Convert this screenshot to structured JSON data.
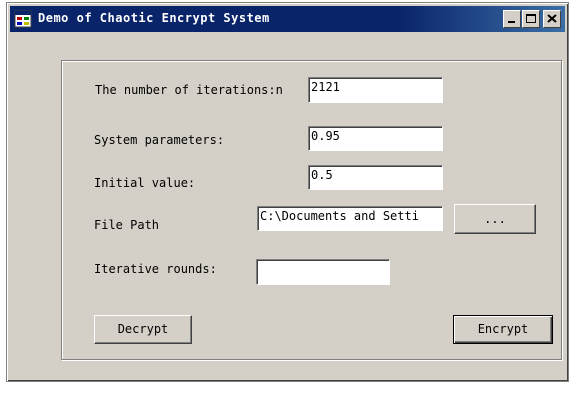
{
  "window": {
    "title": "Demo of Chaotic Encrypt System"
  },
  "form": {
    "iterations_label": "The number of iterations:n",
    "iterations_value": "2121",
    "system_params_label": "System parameters:",
    "system_params_value": "0.95",
    "initial_value_label": "Initial value:",
    "initial_value_value": "0.5",
    "file_path_label": "File Path",
    "file_path_value": "C:\\Documents and Setti",
    "browse_label": "...",
    "iterative_rounds_label": "Iterative rounds:",
    "iterative_rounds_value": "",
    "decrypt_label": "Decrypt",
    "encrypt_label": "Encrypt"
  },
  "colors": {
    "titlebar": "#0a246a",
    "face": "#d4d0c8"
  }
}
